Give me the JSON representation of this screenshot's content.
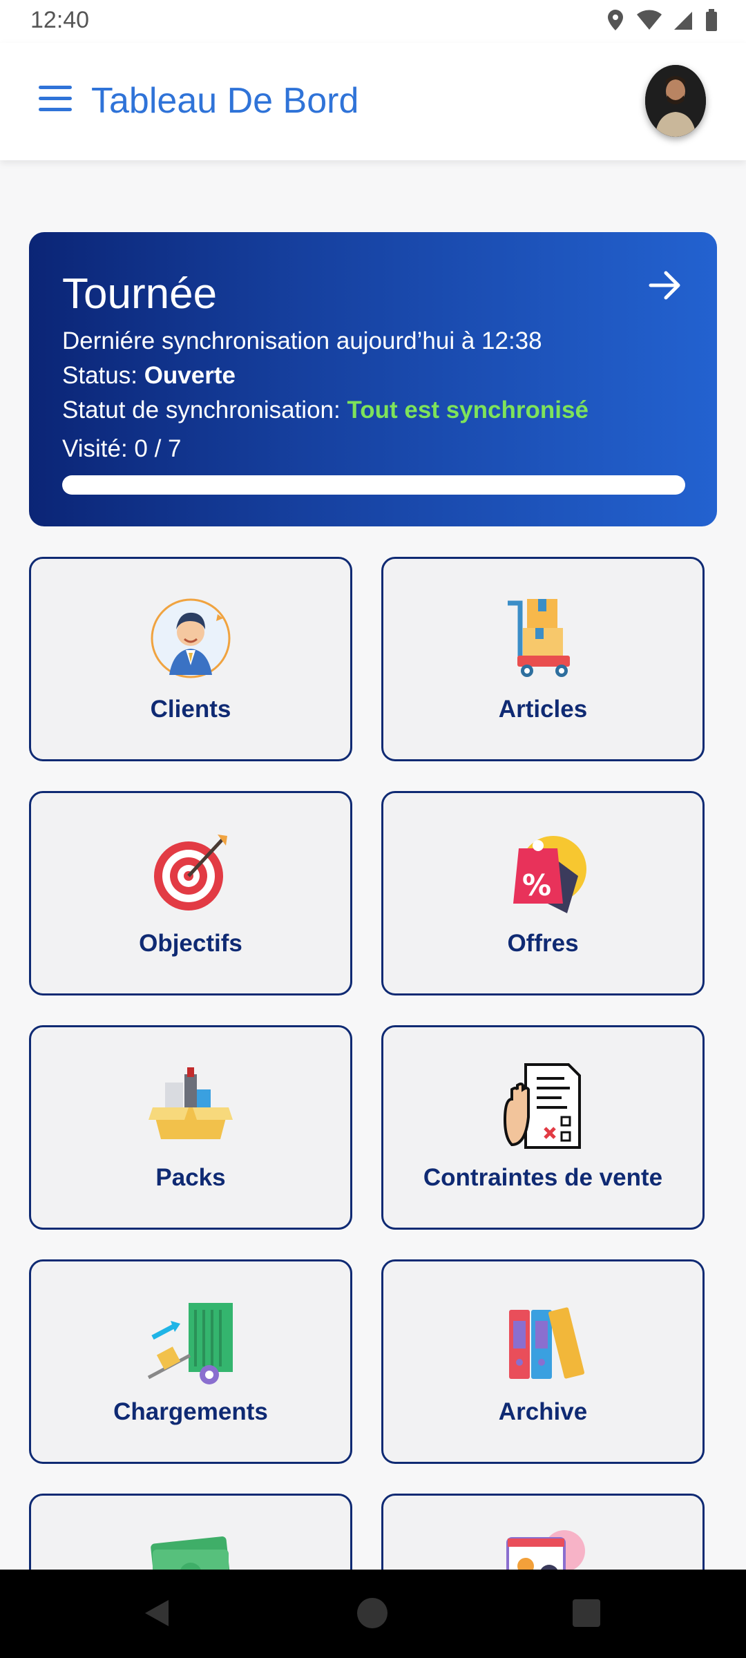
{
  "status_bar": {
    "time": "12:40"
  },
  "app_bar": {
    "title": "Tableau De Bord"
  },
  "tour": {
    "title": "Tournée",
    "last_sync": "Derniére synchronisation aujourd’hui à 12:38",
    "status_label": "Status:",
    "status_value": "Ouverte",
    "sync_label": "Statut de synchronisation:",
    "sync_value": "Tout est synchronisé",
    "visited_label": "Visité:",
    "visited_value": "0 / 7",
    "visited_progress": 0
  },
  "tiles": [
    {
      "label": "Clients",
      "icon": "client-icon"
    },
    {
      "label": "Articles",
      "icon": "cart-boxes-icon"
    },
    {
      "label": "Objectifs",
      "icon": "target-icon"
    },
    {
      "label": "Offres",
      "icon": "discount-tag-icon"
    },
    {
      "label": "Packs",
      "icon": "box-bottles-icon"
    },
    {
      "label": "Contraintes de vente",
      "icon": "checklist-stop-icon"
    },
    {
      "label": "Chargements",
      "icon": "loading-truck-icon"
    },
    {
      "label": "Archive",
      "icon": "binders-icon"
    },
    {
      "label": "",
      "icon": "money-icon"
    },
    {
      "label": "",
      "icon": "settings-screen-icon"
    }
  ],
  "colors": {
    "accent": "#2f73d8",
    "tile_border": "#0f2a73",
    "sync_ok": "#7ee35a",
    "card_gradient_start": "#0b2576",
    "card_gradient_end": "#2362d0"
  }
}
